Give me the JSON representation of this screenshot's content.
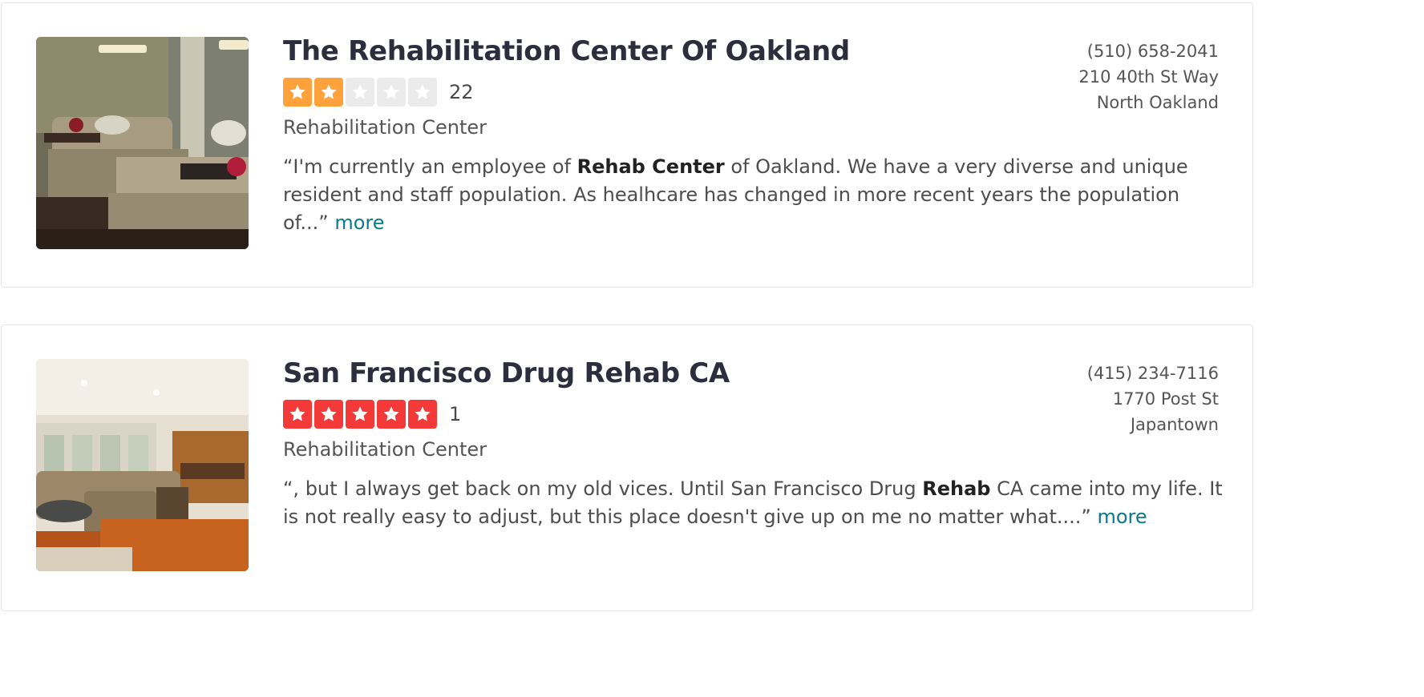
{
  "results": [
    {
      "name": "The Rehabilitation Center Of Oakland",
      "rating": 2,
      "review_count": "22",
      "category": "Rehabilitation Center",
      "snippet_before": "“I'm currently an employee of ",
      "snippet_bold": "Rehab Center",
      "snippet_after": " of Oakland. We have a very diverse and unique resident and staff population. As healhcare has changed in more recent years the population of...” ",
      "more_label": "more",
      "phone": "(510) 658-2041",
      "address": "210 40th St Way",
      "neighborhood": "North Oakland",
      "star_color": "#ffa23c",
      "photo": "nursing-room-two-beds"
    },
    {
      "name": "San Francisco Drug Rehab CA",
      "rating": 5,
      "review_count": "1",
      "category": "Rehabilitation Center",
      "snippet_before": "“, but I always get back on my old vices. Until San Francisco Drug ",
      "snippet_bold": "Rehab",
      "snippet_after": " CA came into my life. It is not really easy to adjust, but this place doesn't give up on me no matter what....” ",
      "more_label": "more",
      "phone": "(415) 234-7116",
      "address": "1770 Post St",
      "neighborhood": "Japantown",
      "star_color": "#f43939",
      "photo": "living-room-sectional-sofa"
    }
  ],
  "colors": {
    "star_empty": "#ebebeb",
    "link": "#0b7a8a",
    "title": "#2d2e3d"
  }
}
